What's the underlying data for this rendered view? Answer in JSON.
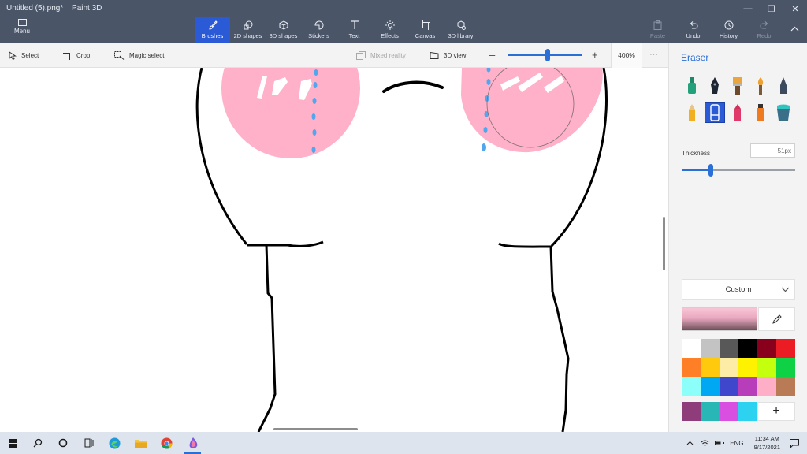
{
  "window": {
    "file_name": "Untitled (5).png*",
    "app_name": "Paint 3D"
  },
  "menu_label": "Menu",
  "tools": [
    {
      "label": "Brushes",
      "icon": "brush-icon",
      "active": true
    },
    {
      "label": "2D shapes",
      "icon": "2d-shapes-icon"
    },
    {
      "label": "3D shapes",
      "icon": "3d-shapes-icon"
    },
    {
      "label": "Stickers",
      "icon": "stickers-icon"
    },
    {
      "label": "Text",
      "icon": "text-icon"
    },
    {
      "label": "Effects",
      "icon": "effects-icon"
    },
    {
      "label": "Canvas",
      "icon": "canvas-icon"
    },
    {
      "label": "3D library",
      "icon": "3d-library-icon"
    }
  ],
  "actions": {
    "paste": "Paste",
    "undo": "Undo",
    "history": "History",
    "redo": "Redo"
  },
  "subtoolbar": {
    "select": "Select",
    "crop": "Crop",
    "magic_select": "Magic select",
    "mixed_reality": "Mixed reality",
    "view_3d": "3D view",
    "zoom_value": "400%",
    "zoom_level": 0.53
  },
  "panel": {
    "title": "Eraser",
    "brushes": [
      "marker-icon",
      "calligraphy-pen-icon",
      "oil-brush-icon",
      "watercolor-icon",
      "pixel-pen-icon",
      "pencil-icon",
      "eraser-icon",
      "crayon-icon",
      "spray-can-icon",
      "fill-icon"
    ],
    "selected_brush": "eraser-icon",
    "thickness_label": "Thickness",
    "thickness_value": "51px",
    "thickness_level": 0.26,
    "color_mode": "Custom",
    "current_color": "#f7c5d6",
    "palette": [
      "#ffffff",
      "#c3c3c3",
      "#585858",
      "#000000",
      "#88001b",
      "#ec1c24",
      "#ff7f27",
      "#ffc90e",
      "#fdeca6",
      "#fff200",
      "#c4ff0e",
      "#0ed145",
      "#8cfffb",
      "#00a8f3",
      "#3f48cc",
      "#b83dba",
      "#ffaec8",
      "#b97a56"
    ],
    "custom_colors": [
      "#8e3d7a",
      "#28b7b4",
      "#d94fe0",
      "#2dd2f0"
    ]
  },
  "taskbar": {
    "language": "ENG",
    "time": "11:34 AM",
    "date": "9/17/2021"
  }
}
